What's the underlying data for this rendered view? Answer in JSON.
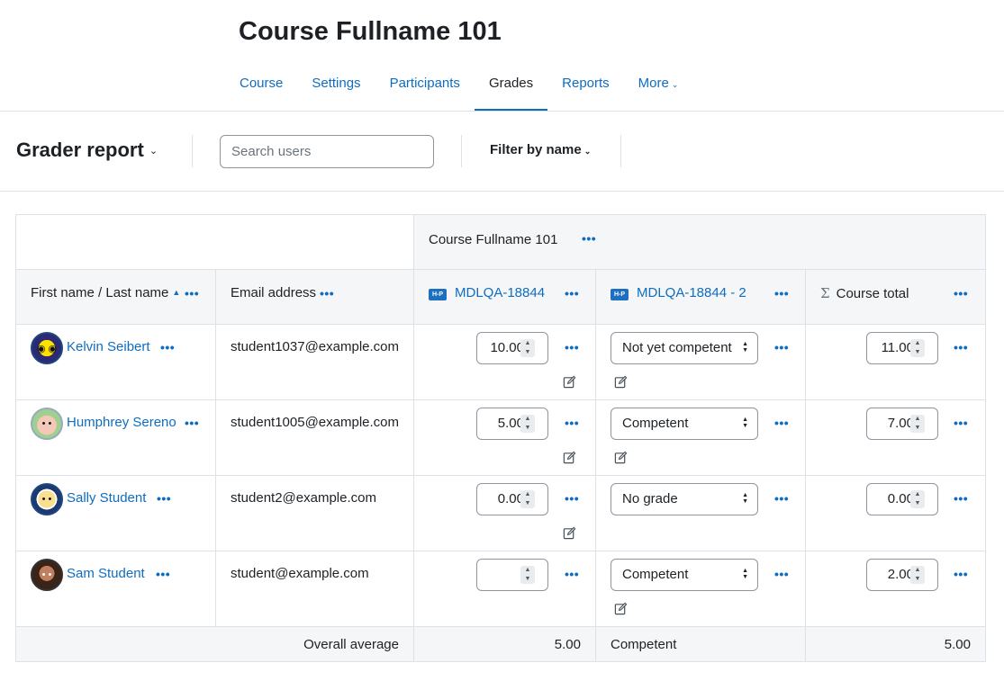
{
  "course": {
    "title": "Course Fullname 101",
    "nav": [
      {
        "label": "Course"
      },
      {
        "label": "Settings"
      },
      {
        "label": "Participants"
      },
      {
        "label": "Grades"
      },
      {
        "label": "Reports"
      },
      {
        "label": "More"
      }
    ],
    "active_tab": "Grades"
  },
  "action_bar": {
    "report_title": "Grader report",
    "search_placeholder": "Search users",
    "filter_label": "Filter by name"
  },
  "table": {
    "category_header": "Course Fullname 101",
    "columns": {
      "name": "First name / Last name",
      "email": "Email address",
      "item1": "MDLQA-18844",
      "item2": "MDLQA-18844 - 2",
      "total": "Course total"
    },
    "hp_icon_label": "H-P",
    "rows": [
      {
        "name": "Kelvin Seibert",
        "email": "student1037@example.com",
        "item1": "10.00",
        "item2": "Not yet competent",
        "total": "11.00"
      },
      {
        "name": "Humphrey Sereno",
        "email": "student1005@example.com",
        "item1": "5.00",
        "item2": "Competent",
        "total": "7.00"
      },
      {
        "name": "Sally Student",
        "email": "student2@example.com",
        "item1": "0.00",
        "item2": "No grade",
        "total": "0.00"
      },
      {
        "name": "Sam Student",
        "email": "student@example.com",
        "item1": "",
        "item2": "Competent",
        "total": "2.00"
      }
    ],
    "average": {
      "label": "Overall average",
      "item1": "5.00",
      "item2": "Competent",
      "total": "5.00"
    }
  },
  "colors": {
    "link": "#0f6cbf",
    "header_bg": "#f5f6f7",
    "border": "#dee2e6"
  }
}
